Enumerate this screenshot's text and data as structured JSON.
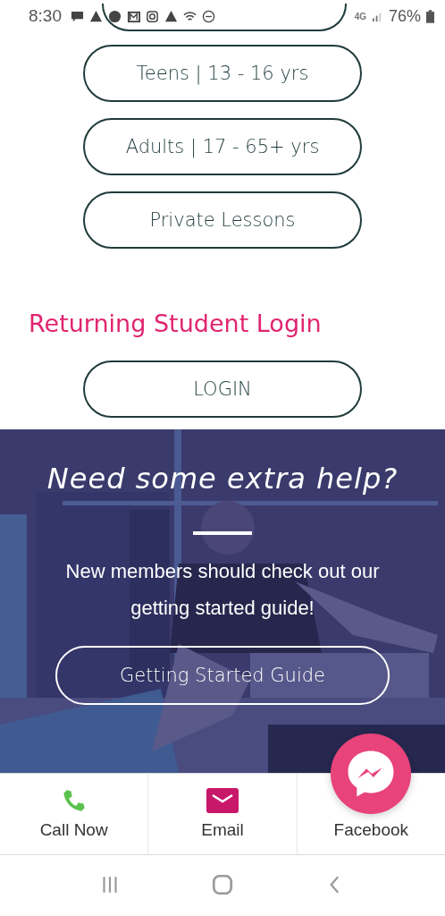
{
  "status_bar": {
    "time": "8:30",
    "network": "4G",
    "battery": "76%"
  },
  "program_buttons": [
    {
      "label": "Teens | 13 - 16 yrs"
    },
    {
      "label": "Adults | 17 - 65+ yrs"
    },
    {
      "label": "Private Lessons"
    }
  ],
  "login_section": {
    "heading": "Returning Student Login",
    "button": "LOGIN"
  },
  "help_banner": {
    "title": "Need some extra help?",
    "text": "New members should check out our getting started guide!",
    "button": "Getting Started Guide"
  },
  "bottom_bar": [
    {
      "kind": "phone",
      "label": "Call Now"
    },
    {
      "kind": "email",
      "label": "Email"
    },
    {
      "kind": "facebook",
      "label": "Facebook"
    }
  ]
}
